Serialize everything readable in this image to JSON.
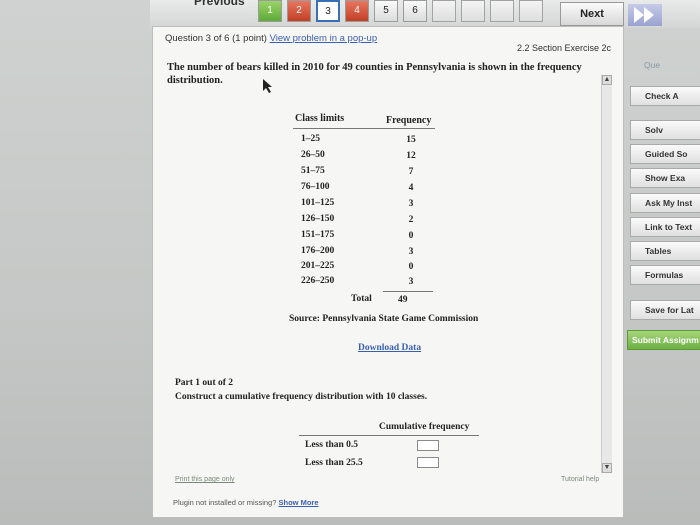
{
  "nav": {
    "previous_label": "Previous",
    "questions": [
      "1",
      "2",
      "3",
      "4",
      "5",
      "6"
    ],
    "next_label": "Next"
  },
  "question": {
    "header_prefix": "Question 3 of 6 (1 point)",
    "popup_link": "View problem in a pop-up",
    "section": "2.2 Section Exercise 2c",
    "prompt": "The number of bears killed in 2010 for 49 counties in Pennsylvania is shown in the frequency distribution."
  },
  "table": {
    "col_class": "Class limits",
    "col_freq": "Frequency",
    "rows": [
      {
        "c": "1–25",
        "f": "15"
      },
      {
        "c": "26–50",
        "f": "12"
      },
      {
        "c": "51–75",
        "f": "7"
      },
      {
        "c": "76–100",
        "f": "4"
      },
      {
        "c": "101–125",
        "f": "3"
      },
      {
        "c": "126–150",
        "f": "2"
      },
      {
        "c": "151–175",
        "f": "0"
      },
      {
        "c": "176–200",
        "f": "3"
      },
      {
        "c": "201–225",
        "f": "0"
      },
      {
        "c": "226–250",
        "f": "3"
      }
    ],
    "total_label": "Total",
    "total_value": "49",
    "source": "Source: Pennsylvania State Game Commission"
  },
  "download_link": "Download Data",
  "part": {
    "title": "Part 1 out of 2",
    "instruction": "Construct a cumulative frequency distribution with 10 classes.",
    "cum_header": "Cumulative frequency",
    "rows": [
      "Less than 0.5",
      "Less than 25.5"
    ],
    "values": [
      "",
      ""
    ]
  },
  "footer": {
    "print_link": "Print this page only",
    "tutorial": "Tutorial help",
    "plugin_text": "Plugin not installed or missing?",
    "show_more": "Show More"
  },
  "sidebar": {
    "question_tab": "Que",
    "buttons": [
      "Check A",
      "Solv",
      "Guided So",
      "Show Exa",
      "Ask My Inst",
      "Link to Text",
      "Tables",
      "Formulas",
      "Save for Lat",
      "Submit Assignm"
    ]
  }
}
